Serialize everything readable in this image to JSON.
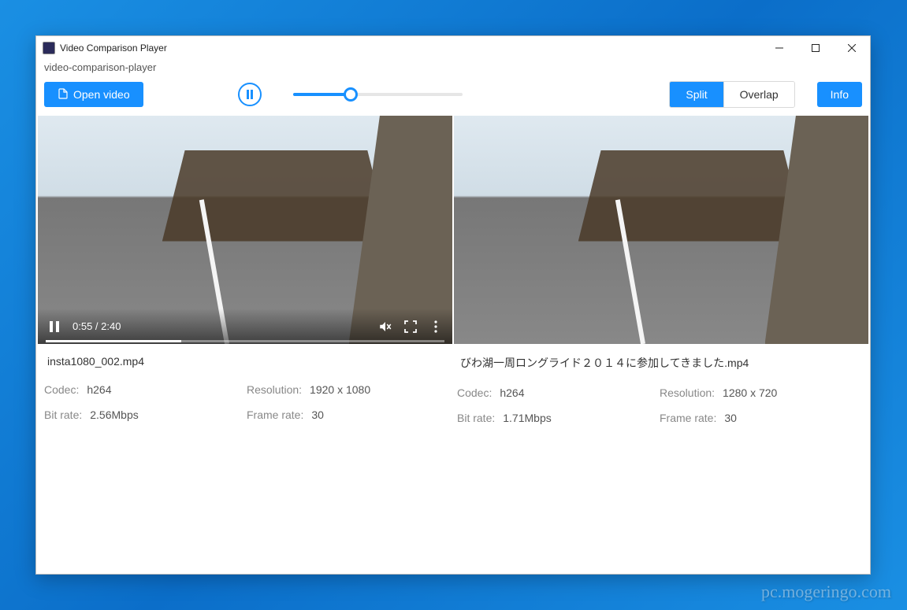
{
  "window": {
    "title": "Video Comparison Player",
    "subtitle": "video-comparison-player"
  },
  "toolbar": {
    "open_label": "Open video",
    "modes": {
      "split": "Split",
      "overlap": "Overlap",
      "info": "Info"
    },
    "slider_percent": 34
  },
  "player": {
    "time_current": "0:55",
    "time_total": "2:40",
    "progress_percent": 34
  },
  "left": {
    "filename": "insta1080_002.mp4",
    "codec_label": "Codec:",
    "codec": "h264",
    "resolution_label": "Resolution:",
    "resolution": "1920 x 1080",
    "bitrate_label": "Bit rate:",
    "bitrate": "2.56Mbps",
    "framerate_label": "Frame rate:",
    "framerate": "30"
  },
  "right": {
    "filename": "びわ湖一周ロングライド２０１４に参加してきました.mp4",
    "codec_label": "Codec:",
    "codec": "h264",
    "resolution_label": "Resolution:",
    "resolution": "1280 x 720",
    "bitrate_label": "Bit rate:",
    "bitrate": "1.71Mbps",
    "framerate_label": "Frame rate:",
    "framerate": "30"
  },
  "watermark": "pc.mogeringo.com"
}
